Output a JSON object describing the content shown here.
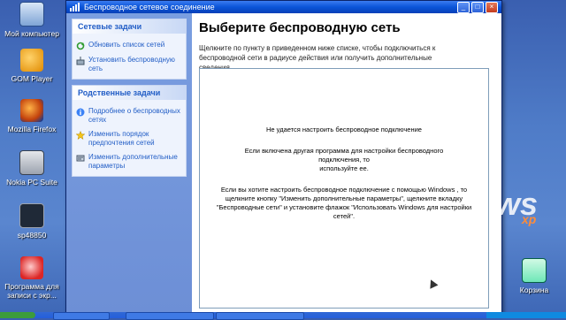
{
  "desktop": {
    "icons": [
      {
        "label": "Мой компьютер",
        "icon": "my-computer-icon"
      },
      {
        "label": "GOM Player",
        "icon": "gom-player-icon"
      },
      {
        "label": "Mozilla Firefox",
        "icon": "firefox-icon"
      },
      {
        "label": "Nokia PC Suite",
        "icon": "nokia-pc-suite-icon"
      },
      {
        "label": "sp48850",
        "icon": "sp48850-icon"
      },
      {
        "label": "Программа для записи с экр...",
        "icon": "screen-recorder-icon"
      },
      {
        "label": "Корзина",
        "icon": "recycle-bin-icon"
      }
    ]
  },
  "window": {
    "title": "Беспроводное сетевое соединение",
    "controls": {
      "minimize": "_",
      "maximize": "□",
      "close": "×"
    }
  },
  "sidebar": {
    "network_tasks": {
      "header": "Сетевые задачи",
      "items": [
        {
          "label": "Обновить список сетей",
          "icon": "refresh-icon"
        },
        {
          "label": "Установить беспроводную сеть",
          "icon": "wireless-setup-icon"
        }
      ]
    },
    "related_tasks": {
      "header": "Родственные задачи",
      "items": [
        {
          "label": "Подробнее о беспроводных сетях",
          "icon": "info-icon"
        },
        {
          "label": "Изменить порядок предпочтения сетей",
          "icon": "star-icon"
        },
        {
          "label": "Изменить дополнительные параметры",
          "icon": "settings-icon"
        }
      ]
    }
  },
  "main": {
    "heading": "Выберите беспроводную сеть",
    "intro": "Щелкните по пункту в приведенном ниже списке, чтобы подключиться к беспроводной сети в радиусе действия или получить дополнительные сведения.",
    "message": {
      "error": "Не удается настроить беспроводное подключение",
      "line1": "Если включена другая программа для настройки беспроводного подключения, то",
      "line2": "используйте ее.",
      "line3": "Если вы хотите настроить беспроводное подключение с помощью Windows , то щелкните кнопку \"Изменить дополнительные параметры\", щелкните вкладку \"Беспроводные сети\" и установите флажок \"Использовать Windows для настройки сетей\"."
    }
  },
  "colors": {
    "titlebar": "#0a54d8",
    "sidebar": "#6d8fd6",
    "link": "#215dc6",
    "desktop": "#4f7cc8"
  }
}
